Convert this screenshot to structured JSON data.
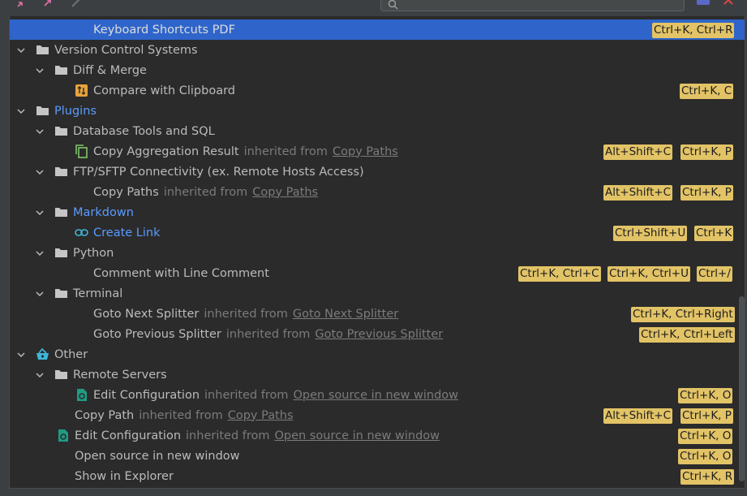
{
  "search": {
    "placeholder": ""
  },
  "colors": {
    "selection": "#2f65ca",
    "shortcut_bg": "#e2c366",
    "link_blue": "#5a9bff"
  },
  "rows": [
    {
      "id": "kb-pdf",
      "label": "Keyboard Shortcuts PDF",
      "shortcuts": [
        "Ctrl+K, Ctrl+R"
      ]
    },
    {
      "id": "vcs",
      "label": "Version Control Systems"
    },
    {
      "id": "diff",
      "label": "Diff & Merge"
    },
    {
      "id": "compare",
      "label": "Compare with Clipboard",
      "shortcuts": [
        "Ctrl+K, C"
      ]
    },
    {
      "id": "plugins",
      "label": "Plugins"
    },
    {
      "id": "dbtools",
      "label": "Database Tools and SQL"
    },
    {
      "id": "copy-agg",
      "label": "Copy Aggregation Result",
      "inherited": "inherited from",
      "link": "Copy Paths",
      "shortcuts": [
        "Alt+Shift+C",
        "Ctrl+K, P"
      ]
    },
    {
      "id": "ftp",
      "label": "FTP/SFTP Connectivity (ex. Remote Hosts Access)"
    },
    {
      "id": "copy-paths",
      "label": "Copy Paths",
      "inherited": "inherited from",
      "link": "Copy Paths",
      "shortcuts": [
        "Alt+Shift+C",
        "Ctrl+K, P"
      ]
    },
    {
      "id": "markdown",
      "label": "Markdown"
    },
    {
      "id": "create-link",
      "label": "Create Link",
      "shortcuts": [
        "Ctrl+Shift+U",
        "Ctrl+K"
      ]
    },
    {
      "id": "python",
      "label": "Python"
    },
    {
      "id": "comment",
      "label": "Comment with Line Comment",
      "shortcuts": [
        "Ctrl+K, Ctrl+C",
        "Ctrl+K, Ctrl+U",
        "Ctrl+/"
      ]
    },
    {
      "id": "terminal",
      "label": "Terminal"
    },
    {
      "id": "goto-next",
      "label": "Goto Next Splitter",
      "inherited": "inherited from",
      "link": "Goto Next Splitter",
      "shortcuts": [
        "Ctrl+K, Ctrl+Right"
      ]
    },
    {
      "id": "goto-prev",
      "label": "Goto Previous Splitter",
      "inherited": "inherited from",
      "link": "Goto Previous Splitter",
      "shortcuts": [
        "Ctrl+K, Ctrl+Left"
      ]
    },
    {
      "id": "other",
      "label": "Other"
    },
    {
      "id": "remote",
      "label": "Remote Servers"
    },
    {
      "id": "edit-conf-1",
      "label": "Edit Configuration",
      "inherited": "inherited from",
      "link": "Open source in new window",
      "shortcuts": [
        "Ctrl+K, O"
      ]
    },
    {
      "id": "copy-path",
      "label": "Copy Path",
      "inherited": "inherited from",
      "link": "Copy Paths",
      "shortcuts": [
        "Alt+Shift+C",
        "Ctrl+K, P"
      ]
    },
    {
      "id": "edit-conf-2",
      "label": "Edit Configuration",
      "inherited": "inherited from",
      "link": "Open source in new window",
      "shortcuts": [
        "Ctrl+K, O"
      ]
    },
    {
      "id": "open-src",
      "label": "Open source in new window",
      "shortcuts": [
        "Ctrl+K, O"
      ]
    },
    {
      "id": "show-explorer",
      "label": "Show in Explorer",
      "shortcuts": [
        "Ctrl+K, R"
      ]
    }
  ]
}
